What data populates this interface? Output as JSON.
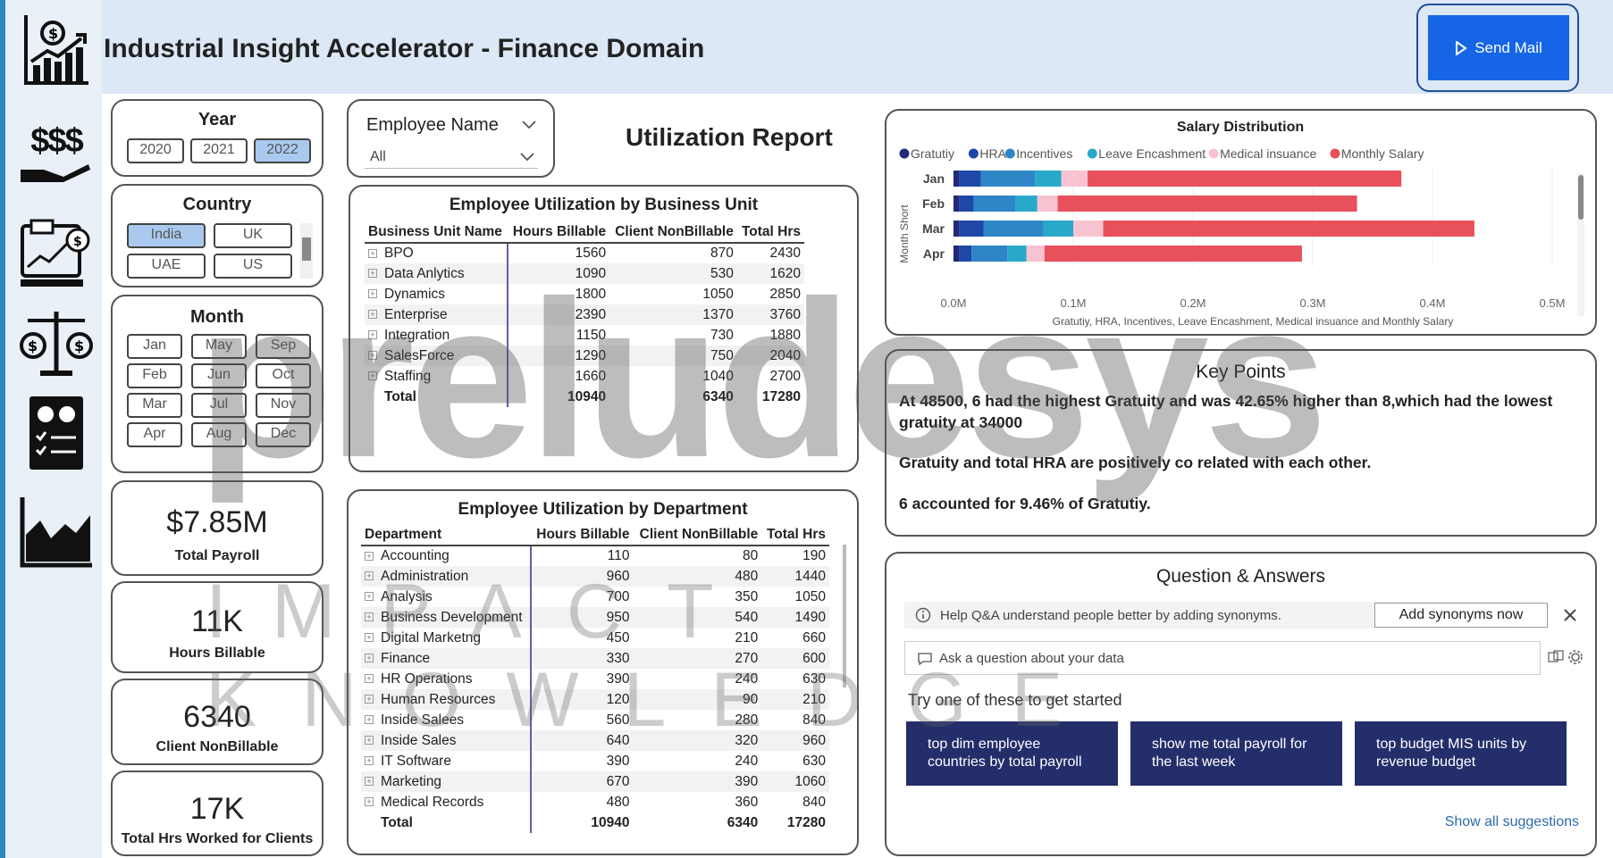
{
  "app": {
    "title": "Industrial Insight Accelerator - Finance Domain",
    "send_label": "Send Mail"
  },
  "sidebar": {
    "icons": [
      "finance-chart-icon",
      "money-hand-icon",
      "report-screen-icon",
      "balance-scale-icon",
      "checklist-report-icon",
      "area-chart-icon"
    ],
    "money_text": "$$$"
  },
  "year": {
    "title": "Year",
    "options": [
      "2020",
      "2021",
      "2022"
    ],
    "selected": "2022"
  },
  "country": {
    "title": "Country",
    "options": [
      "India",
      "UK",
      "UAE",
      "US"
    ],
    "selected": "India"
  },
  "month": {
    "title": "Month",
    "options": [
      "Jan",
      "May",
      "Sep",
      "Feb",
      "Jun",
      "Oct",
      "Mar",
      "Jul",
      "Nov",
      "Apr",
      "Aug",
      "Dec"
    ]
  },
  "kpis": [
    {
      "value": "$7.85M",
      "label": "Total Payroll"
    },
    {
      "value": "11K",
      "label": "Hours Billable"
    },
    {
      "value": "6340",
      "label": "Client NonBillable"
    },
    {
      "value": "17K",
      "label": "Total Hrs Worked for Clients"
    }
  ],
  "employee_filter": {
    "title": "Employee Name",
    "value": "All"
  },
  "report_title": "Utilization Report",
  "bu_table": {
    "title": "Employee Utilization by Business Unit",
    "headers": [
      "Business Unit Name",
      "Hours Billable",
      "Client NonBillable",
      "Total Hrs"
    ],
    "rows": [
      [
        "BPO",
        "1560",
        "870",
        "2430"
      ],
      [
        "Data Anlytics",
        "1090",
        "530",
        "1620"
      ],
      [
        "Dynamics",
        "1800",
        "1050",
        "2850"
      ],
      [
        "Enterprise",
        "2390",
        "1370",
        "3760"
      ],
      [
        "Integration",
        "1150",
        "730",
        "1880"
      ],
      [
        "SalesForce",
        "1290",
        "750",
        "2040"
      ],
      [
        "Staffing",
        "1660",
        "1040",
        "2700"
      ]
    ],
    "total": [
      "Total",
      "10940",
      "6340",
      "17280"
    ]
  },
  "dept_table": {
    "title": "Employee Utilization by Department",
    "headers": [
      "Department",
      "Hours Billable",
      "Client NonBillable",
      "Total Hrs"
    ],
    "rows": [
      [
        "Accounting",
        "110",
        "80",
        "190"
      ],
      [
        "Administration",
        "960",
        "480",
        "1440"
      ],
      [
        "Analysis",
        "700",
        "350",
        "1050"
      ],
      [
        "Business Development",
        "950",
        "540",
        "1490"
      ],
      [
        "Digital Marketng",
        "450",
        "210",
        "660"
      ],
      [
        "Finance",
        "330",
        "270",
        "600"
      ],
      [
        "HR Operations",
        "390",
        "240",
        "630"
      ],
      [
        "Human Resources",
        "120",
        "90",
        "210"
      ],
      [
        "Inside Salees",
        "560",
        "280",
        "840"
      ],
      [
        "Inside Sales",
        "640",
        "320",
        "960"
      ],
      [
        "IT Software",
        "390",
        "240",
        "630"
      ],
      [
        "Marketing",
        "670",
        "390",
        "1060"
      ],
      [
        "Medical Records",
        "480",
        "360",
        "840"
      ]
    ],
    "total": [
      "Total",
      "10940",
      "6340",
      "17280"
    ]
  },
  "chart_data": {
    "type": "bar",
    "orientation": "horizontal",
    "stacked": true,
    "title": "Salary Distribution",
    "categories": [
      "Jan",
      "Feb",
      "Mar",
      "Apr"
    ],
    "ylabel": "Month Short",
    "xlabel": "Gratutiy, HRA, Incentives, Leave Encashment, Medical insuance and Monthly Salary",
    "xlim": [
      0,
      0.5
    ],
    "xticks": [
      "0.0M",
      "0.1M",
      "0.2M",
      "0.3M",
      "0.4M",
      "0.5M"
    ],
    "legend_position": "top-left",
    "series": [
      {
        "name": "Gratutiy",
        "color": "#1f2a7a",
        "values": [
          0.005,
          0.005,
          0.005,
          0.005
        ]
      },
      {
        "name": "HRA",
        "color": "#1f47a8",
        "values": [
          0.018,
          0.012,
          0.02,
          0.01
        ]
      },
      {
        "name": "Incentives",
        "color": "#2e86c7",
        "values": [
          0.045,
          0.035,
          0.05,
          0.03
        ]
      },
      {
        "name": "Leave Encashment",
        "color": "#29a9c9",
        "values": [
          0.022,
          0.018,
          0.025,
          0.016
        ]
      },
      {
        "name": "Medical insuance",
        "color": "#f7c3d1",
        "values": [
          0.022,
          0.017,
          0.025,
          0.015
        ]
      },
      {
        "name": "Monthly Salary",
        "color": "#e8505b",
        "values": [
          0.262,
          0.25,
          0.31,
          0.215
        ]
      }
    ]
  },
  "key_points": {
    "title": "Key Points",
    "items": [
      "At 48500, 6 had the highest Gratuity and was 42.65% higher than 8,which had the lowest gratuity at 34000",
      "Gratuity and total HRA are positively co related with each other.",
      "6 accounted for 9.46% of Gratutiy."
    ]
  },
  "qa": {
    "title": "Question & Answers",
    "hint": "Help Q&A understand people better by adding synonyms.",
    "add_synonyms": "Add synonyms now",
    "placeholder": "Ask a question about your data",
    "try_label": "Try one of these to get started",
    "suggestions": [
      "top dim employee countries by total payroll",
      "show me total payroll for the last week",
      "top budget MIS units by revenue budget"
    ],
    "show_all": "Show all suggestions"
  },
  "watermark": {
    "logo": "preludesys",
    "tagline": "IMPACT KNOWLEDGE"
  },
  "colors": {
    "accent": "#1565e6",
    "header_bg": "#dce8f5",
    "sidebar_bg": "#e9f0f8",
    "qa_button": "#242e6b"
  }
}
